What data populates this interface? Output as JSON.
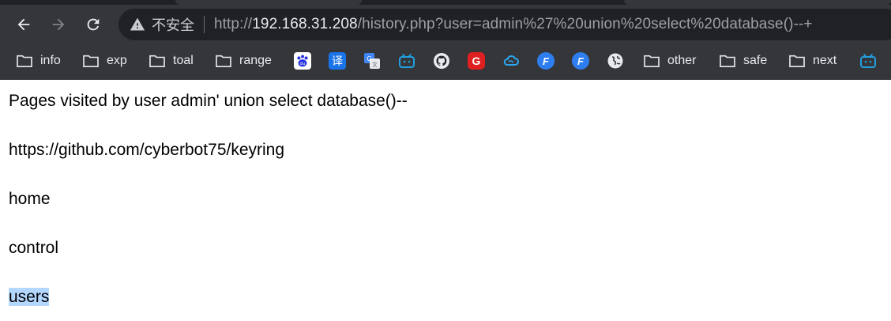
{
  "browser": {
    "security_label": "不安全",
    "url_prefix": "http://",
    "url_host": "192.168.31.208",
    "url_path": "/history.php?user=admin%27%20union%20select%20database()--+"
  },
  "bookmarks": [
    {
      "type": "folder",
      "label": "info"
    },
    {
      "type": "folder",
      "label": "exp"
    },
    {
      "type": "folder",
      "label": "toal"
    },
    {
      "type": "folder",
      "label": "range"
    },
    {
      "type": "favicon",
      "icon": "baidu-icon"
    },
    {
      "type": "favicon",
      "icon": "translate-icon",
      "glyph": "译"
    },
    {
      "type": "favicon",
      "icon": "google-translate-icon"
    },
    {
      "type": "favicon",
      "icon": "bilibili-icon"
    },
    {
      "type": "favicon",
      "icon": "github-icon"
    },
    {
      "type": "favicon",
      "icon": "g-red-icon",
      "glyph": "G"
    },
    {
      "type": "favicon",
      "icon": "cloud-icon"
    },
    {
      "type": "favicon",
      "icon": "f-blue-icon",
      "glyph": "F"
    },
    {
      "type": "favicon",
      "icon": "f-blue-icon-2",
      "glyph": "F"
    },
    {
      "type": "favicon",
      "icon": "globe-icon"
    },
    {
      "type": "folder",
      "label": "other"
    },
    {
      "type": "folder",
      "label": "safe"
    },
    {
      "type": "folder",
      "label": "next"
    },
    {
      "type": "favicon",
      "icon": "bilibili-icon-2"
    }
  ],
  "page": {
    "heading": "Pages visited by user admin' union select database()--",
    "lines": [
      "https://github.com/cyberbot75/keyring",
      "home",
      "control",
      "users"
    ]
  },
  "colors": {
    "chrome_bg": "#35363a",
    "omnibox_bg": "#202124",
    "selection": "#b4d7ff"
  }
}
